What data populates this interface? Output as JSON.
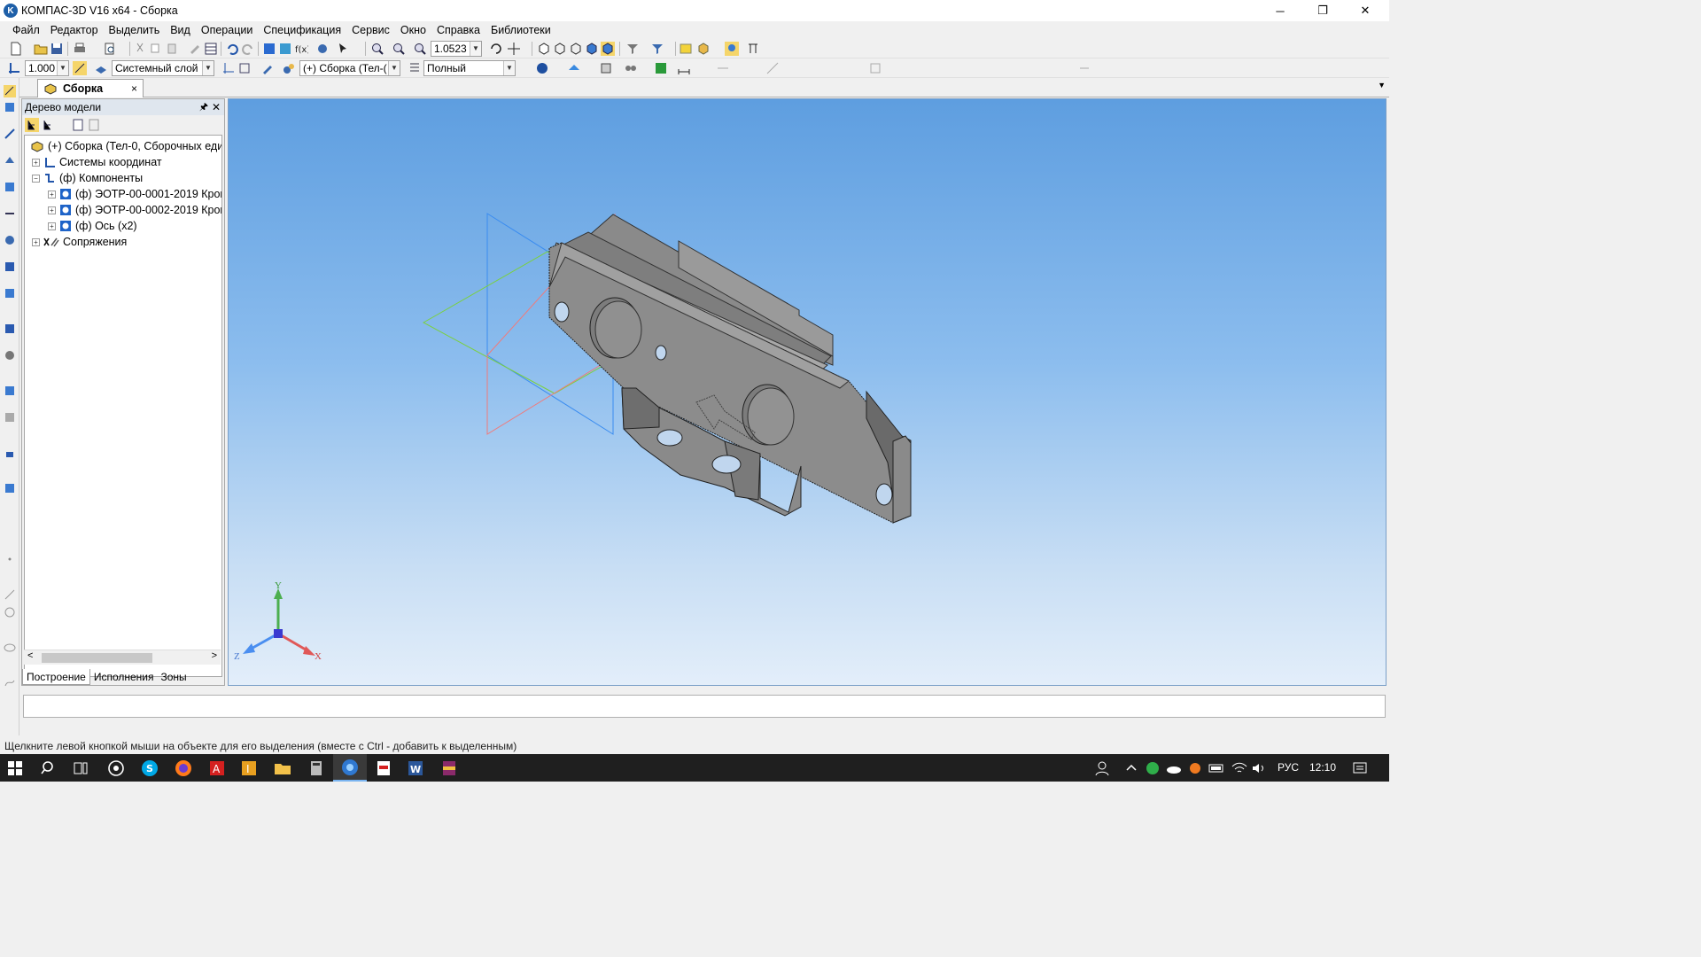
{
  "window": {
    "title": "КОМПАС-3D V16  x64 - Сборка",
    "app_icon_letter": "K",
    "minimize": "─",
    "restore": "❐",
    "close": "✕"
  },
  "menu": [
    {
      "label": "Файл"
    },
    {
      "label": "Редактор"
    },
    {
      "label": "Выделить"
    },
    {
      "label": "Вид"
    },
    {
      "label": "Операции"
    },
    {
      "label": "Спецификация"
    },
    {
      "label": "Сервис"
    },
    {
      "label": "Окно"
    },
    {
      "label": "Справка"
    },
    {
      "label": "Библиотеки"
    }
  ],
  "toolbar_main": {
    "zoom_value": "1.0523"
  },
  "toolbar_current": {
    "step_value": "1.000",
    "layer_value": "Системный слой",
    "assembly_value": "(+) Сборка (Тел-(",
    "display_mode_value": "Полный"
  },
  "document_tab": {
    "label": "Сборка",
    "close": "×"
  },
  "tree_panel": {
    "title": "Дерево модели",
    "pin": "🖈",
    "close": "✕",
    "items": [
      {
        "label": "(+) Сборка (Тел-0, Сборочных еди",
        "expander": ""
      },
      {
        "label": "Системы координат",
        "expander": "+"
      },
      {
        "label": "(ф) Компоненты",
        "expander": "−"
      },
      {
        "label": "(ф) ЭОТР-00-0001-2019 Крон",
        "expander": "+"
      },
      {
        "label": "(ф) ЭОТР-00-0002-2019 Крон",
        "expander": "+"
      },
      {
        "label": "(ф) Ось (x2)",
        "expander": "+"
      },
      {
        "label": "Сопряжения",
        "expander": "+"
      }
    ],
    "scroll_left": "<",
    "scroll_right": ">",
    "bottom_tabs": [
      {
        "label": "Построение"
      },
      {
        "label": "Исполнения"
      },
      {
        "label": "Зоны"
      }
    ]
  },
  "axes": {
    "x": "X",
    "y": "Y",
    "z": "Z"
  },
  "status": {
    "message": "Щелкните левой кнопкой мыши на объекте для его выделения (вместе с Ctrl - добавить к выделенным)"
  },
  "taskbar": {
    "language": "РУС",
    "time": "12:10"
  },
  "colors": {
    "accent": "#1e5fa8",
    "viewport_top": "#5e9ee0",
    "viewport_bottom": "#e3eefa",
    "part_fill": "#8a8a8a",
    "taskbar": "#1f1f1f"
  }
}
